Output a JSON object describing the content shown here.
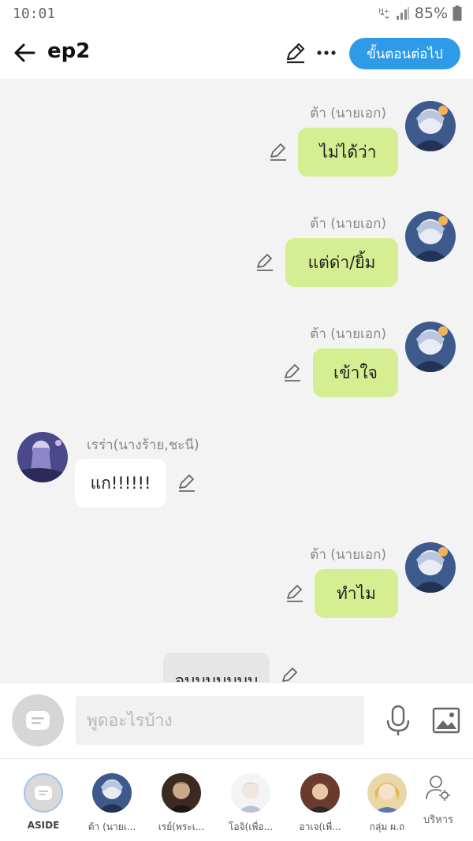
{
  "status_bar": {
    "time": "10:01",
    "battery": "85%"
  },
  "header": {
    "title": "ep2",
    "next_button": "ขั้นตอนต่อไป"
  },
  "messages": [
    {
      "speaker": "ต้า (นายเอก)",
      "text": "ไม่ได้ว่า"
    },
    {
      "speaker": "ต้า (นายเอก)",
      "text": "แต่ด่า/ยิ้ม"
    },
    {
      "speaker": "ต้า (นายเอก)",
      "text": "เข้าใจ"
    },
    {
      "speaker": "เรร่า(นางร้าย,ชะนี)",
      "text": "แก!!!!!!"
    },
    {
      "speaker": "ต้า (นายเอก)",
      "text": "ทำไม"
    },
    {
      "speaker": "",
      "text": "จบบบบบบบ"
    }
  ],
  "composer": {
    "placeholder": "พูดอะไรบ้าง"
  },
  "characters": [
    {
      "label": "ASIDE"
    },
    {
      "label": "ต้า (นายเ..."
    },
    {
      "label": "เรย์(พระเ..."
    },
    {
      "label": "โอจิ(เพื่อ..."
    },
    {
      "label": "อาเจ(เพื่..."
    },
    {
      "label": "กลุ่ม ผ.ถ"
    },
    {
      "label": "บริหาร"
    }
  ],
  "colors": {
    "accent": "#2f9be8",
    "bubble_self": "#d6ee92",
    "bubble_other": "#ffffff"
  }
}
